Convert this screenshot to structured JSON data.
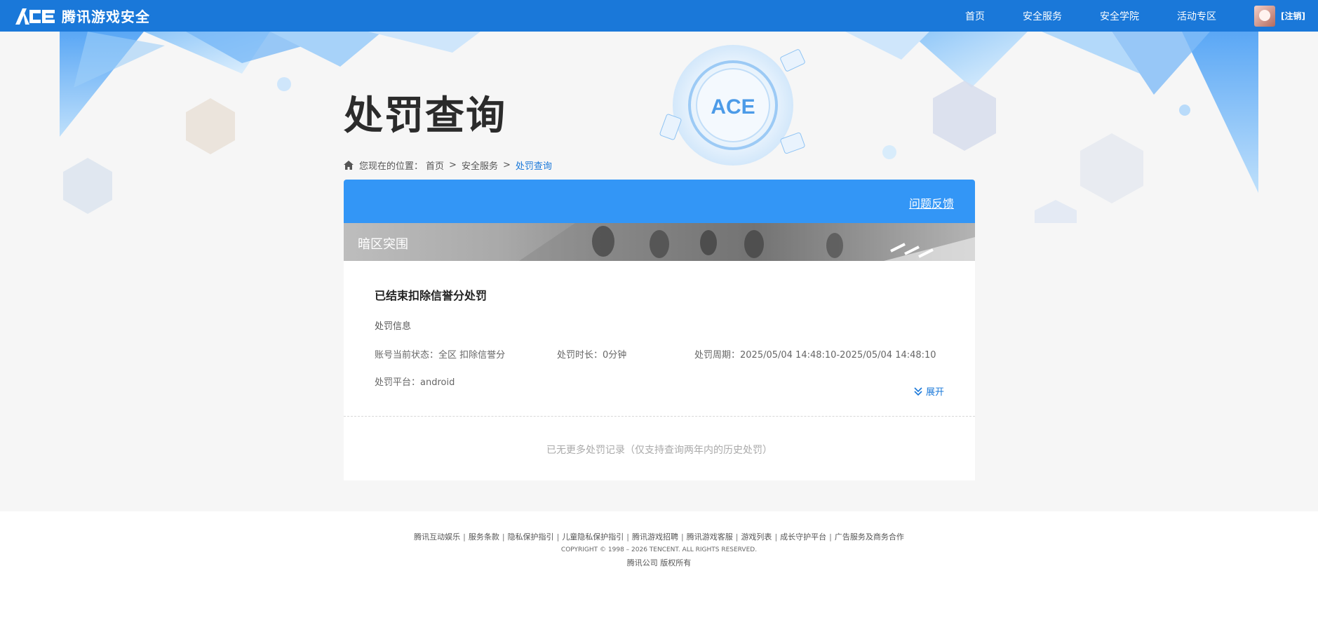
{
  "header": {
    "logo_text": "腾讯游戏安全",
    "nav": [
      "首页",
      "安全服务",
      "安全学院",
      "活动专区"
    ],
    "logout": "[注销]"
  },
  "page": {
    "title": "处罚查询"
  },
  "breadcrumb": {
    "prefix": "您现在的位置：",
    "items": [
      "首页",
      "安全服务",
      "处罚查询"
    ],
    "separator": ">"
  },
  "card": {
    "feedback": "问题反馈",
    "game_name": "暗区突围",
    "record": {
      "title": "已结束扣除信誉分处罚",
      "section_label": "处罚信息",
      "status": "账号当前状态：全区 扣除信誉分",
      "duration": "处罚时长：0分钟",
      "period": "处罚周期：2025/05/04 14:48:10-2025/05/04 14:48:10",
      "platform": "处罚平台：android",
      "expand": "展开"
    },
    "no_more": "已无更多处罚记录（仅支持查询两年内的历史处罚）"
  },
  "footer": {
    "links": [
      "腾讯互动娱乐",
      "服务条款",
      "隐私保护指引",
      "儿童隐私保护指引",
      "腾讯游戏招聘",
      "腾讯游戏客服",
      "游戏列表",
      "成长守护平台",
      "广告服务及商务合作"
    ],
    "copyright": "COPYRIGHT © 1998 – 2026 TENCENT. ALL RIGHTS RESERVED.",
    "owner": "腾讯公司 版权所有"
  },
  "colors": {
    "nav_blue": "#1a78d9",
    "card_head_blue": "#3396f6"
  }
}
